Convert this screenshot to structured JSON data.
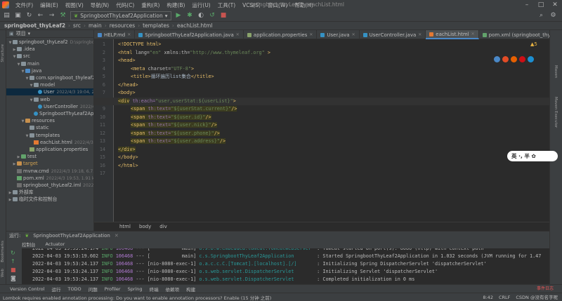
{
  "window": {
    "title": "springboot_thyLeaf2 - eachList.html",
    "menu": [
      "文件(F)",
      "编辑(E)",
      "视图(V)",
      "导航(N)",
      "代码(C)",
      "重构(R)",
      "构建(B)",
      "运行(U)",
      "工具(T)",
      "VCS(S)",
      "窗口(W)",
      "帮助(H)"
    ]
  },
  "toolbar": {
    "run_config": "SpringbootThyLeaf2Application"
  },
  "breadcrumb": [
    "springboot_thyLeaf2",
    "src",
    "main",
    "resources",
    "templates",
    "eachList.html"
  ],
  "project_panel": {
    "title": "项目",
    "rows": [
      {
        "label": "springboot_thyLeaf2",
        "meta": "D:\\springboot_thyle",
        "indent": 0,
        "arrow": "▼",
        "icon": "folder"
      },
      {
        "label": ".idea",
        "meta": "",
        "indent": 1,
        "arrow": "▶",
        "icon": "folder"
      },
      {
        "label": "src",
        "meta": "",
        "indent": 1,
        "arrow": "▼",
        "icon": "folder"
      },
      {
        "label": "main",
        "meta": "",
        "indent": 2,
        "arrow": "▼",
        "icon": "folder"
      },
      {
        "label": "java",
        "meta": "",
        "indent": 3,
        "arrow": "▼",
        "icon": "folder blue"
      },
      {
        "label": "com.springboot_thyleaf2",
        "meta": "",
        "indent": 4,
        "arrow": "▼",
        "icon": "folder"
      },
      {
        "label": "model",
        "meta": "",
        "indent": 5,
        "arrow": "▼",
        "icon": "folder"
      },
      {
        "label": "User",
        "meta": "2022/4/3 19:04, 203",
        "indent": 6,
        "arrow": "",
        "icon": "cls",
        "selected": true
      },
      {
        "label": "web",
        "meta": "",
        "indent": 5,
        "arrow": "▼",
        "icon": "folder"
      },
      {
        "label": "UserController",
        "meta": "2022/4/",
        "indent": 6,
        "arrow": "",
        "icon": "cls"
      },
      {
        "label": "SpringbootThyLeaf2Applic",
        "meta": "",
        "indent": 5,
        "arrow": "",
        "icon": "cls"
      },
      {
        "label": "resources",
        "meta": "",
        "indent": 3,
        "arrow": "▼",
        "icon": "folder orange"
      },
      {
        "label": "static",
        "meta": "",
        "indent": 4,
        "arrow": "",
        "icon": "folder"
      },
      {
        "label": "templates",
        "meta": "",
        "indent": 4,
        "arrow": "▼",
        "icon": "folder"
      },
      {
        "label": "eachList.html",
        "meta": "2022/4/3 19:",
        "indent": 5,
        "arrow": "",
        "icon": "html-ic"
      },
      {
        "label": "application.properties",
        "meta": "",
        "indent": 4,
        "arrow": "",
        "icon": "props-ic"
      },
      {
        "label": "test",
        "meta": "",
        "indent": 2,
        "arrow": "▶",
        "icon": "folder green"
      },
      {
        "label": "target",
        "meta": "",
        "indent": 1,
        "arrow": "▶",
        "icon": "folder orange"
      },
      {
        "label": "mvnw.cmd",
        "meta": "2022/4/3 19:18, 6.73 kB",
        "indent": 1,
        "arrow": "",
        "icon": "cmd-ic"
      },
      {
        "label": "pom.xml",
        "meta": "2022/4/3 19:53, 1.91 kB 28 分钟之前",
        "indent": 1,
        "arrow": "",
        "icon": "xml-ic"
      },
      {
        "label": "springboot_thyLeaf2.iml",
        "meta": "2022/4/3 19:",
        "indent": 1,
        "arrow": "",
        "icon": "cmd-ic"
      },
      {
        "label": "外部库",
        "meta": "",
        "indent": 0,
        "arrow": "▶",
        "icon": "folder"
      },
      {
        "label": "临时文件和控制台",
        "meta": "",
        "indent": 0,
        "arrow": "▶",
        "icon": "folder"
      }
    ]
  },
  "tabs": [
    {
      "label": "HELP.md",
      "color": "#4a88c7"
    },
    {
      "label": "SpringbootThyLeaf2Application.java",
      "color": "#3592c4"
    },
    {
      "label": "application.properties",
      "color": "#8aa36b"
    },
    {
      "label": "User.java",
      "color": "#3592c4"
    },
    {
      "label": "UserController.java",
      "color": "#3592c4"
    },
    {
      "label": "eachList.html",
      "color": "#e37933",
      "active": true
    },
    {
      "label": "pom.xml (springboot_thyLeaf2)",
      "color": "#62a36b"
    }
  ],
  "editor": {
    "warnings": "▲5",
    "lines": [
      "1",
      "2",
      "3",
      "4",
      "5",
      "6",
      "7",
      "8",
      "9",
      "10",
      "11",
      "12",
      "13",
      "14",
      "15",
      "16",
      "17"
    ],
    "code": {
      "l1": "<!DOCTYPE html>",
      "l2_tag": "<html",
      "l2_attr": " lang=",
      "l2_val": "\"en\"",
      "l2_attr2": " xmlns:th=",
      "l2_val2": "\"http://www.thymeleaf.org\"",
      "l2_end": " >",
      "l3": "<head>",
      "l4_tag": "<meta",
      "l4_attr": " charset=",
      "l4_val": "\"UTF-8\"",
      "l4_end": ">",
      "l5_open": "<title>",
      "l5_text": "循环遍历list集合",
      "l5_close": "</title>",
      "l6": "</head>",
      "l7": "<body>",
      "l8_tag": "<div",
      "l8_attr": " th:each=",
      "l8_val": "\"user,userStat:${userList}\"",
      "l8_end": ">",
      "l9_tag": "<span",
      "l9_attr": " th:text=",
      "l9_val": "\"${userStat.current}\"",
      "l9_end": "/>",
      "l10_val": "\"${user.id}\"",
      "l11_val": "\"${user.nick}\"",
      "l12_val": "\"${user.phone}\"",
      "l13_val": "\"${user.address}\"",
      "l14": "</div>",
      "l15": "</body>",
      "l16": "</html>"
    },
    "breadcrumb": [
      "html",
      "body",
      "div"
    ]
  },
  "ime": "英 ·, 半 ✿",
  "run_panel": {
    "label": "运行:",
    "config": "SpringbootThyLeaf2Application",
    "tabs": [
      "控制台",
      "Actuator"
    ],
    "log": [
      {
        "ts": "2022-04-03 19:53:24.174",
        "level": "INFO",
        "pid": "106468",
        "sep": "---",
        "thread": "[           main]",
        "logger": "o.s.b.w.embedded.tomcat.TomcatWebServer ",
        "msg": ": Tomcat started on port(s): 8080 (http) with context path ''"
      },
      {
        "ts": "2022-04-03 19:53:19.602",
        "level": "INFO",
        "pid": "106468",
        "sep": "---",
        "thread": "[           main]",
        "logger": "c.s.SpringbootThyLeaf2Application       ",
        "msg": ": Started SpringbootThyLeaf2Application in 1.032 seconds (JVM running for 1.47"
      },
      {
        "ts": "2022-04-03 19:53:24.137",
        "level": "INFO",
        "pid": "106468",
        "sep": "---",
        "thread": "[nio-8080-exec-1]",
        "logger": "o.a.c.c.C.[Tomcat].[localhost].[/]      ",
        "msg": ": Initializing Spring DispatcherServlet 'dispatcherServlet'"
      },
      {
        "ts": "2022-04-03 19:53:24.137",
        "level": "INFO",
        "pid": "106468",
        "sep": "---",
        "thread": "[nio-8080-exec-1]",
        "logger": "o.s.web.servlet.DispatcherServlet       ",
        "msg": ": Initializing Servlet 'dispatcherServlet'"
      },
      {
        "ts": "2022-04-03 19:53:24.137",
        "level": "INFO",
        "pid": "106468",
        "sep": "---",
        "thread": "[nio-8080-exec-1]",
        "logger": "o.s.web.servlet.DispatcherServlet       ",
        "msg": ": Completed initialization in 0 ms"
      }
    ]
  },
  "bottom_tools": [
    "Version Control",
    "运行",
    "TODO",
    "问题",
    "Profiler",
    "Spring",
    "终端",
    "依赖项",
    "构建"
  ],
  "event_log": "事件日志",
  "status": {
    "message": "Lombok requires enabled annotation processing: Do you want to enable annotation processors? Enable (15 分钟 之前)",
    "position": "8:42",
    "line_ending": "CRLF",
    "watermark": "CSDN @没有名字呢"
  },
  "left_stripe": [
    "Structure",
    "Bookmarks",
    "Web"
  ],
  "right_stripe": [
    "Maven",
    "Maven Executor"
  ]
}
